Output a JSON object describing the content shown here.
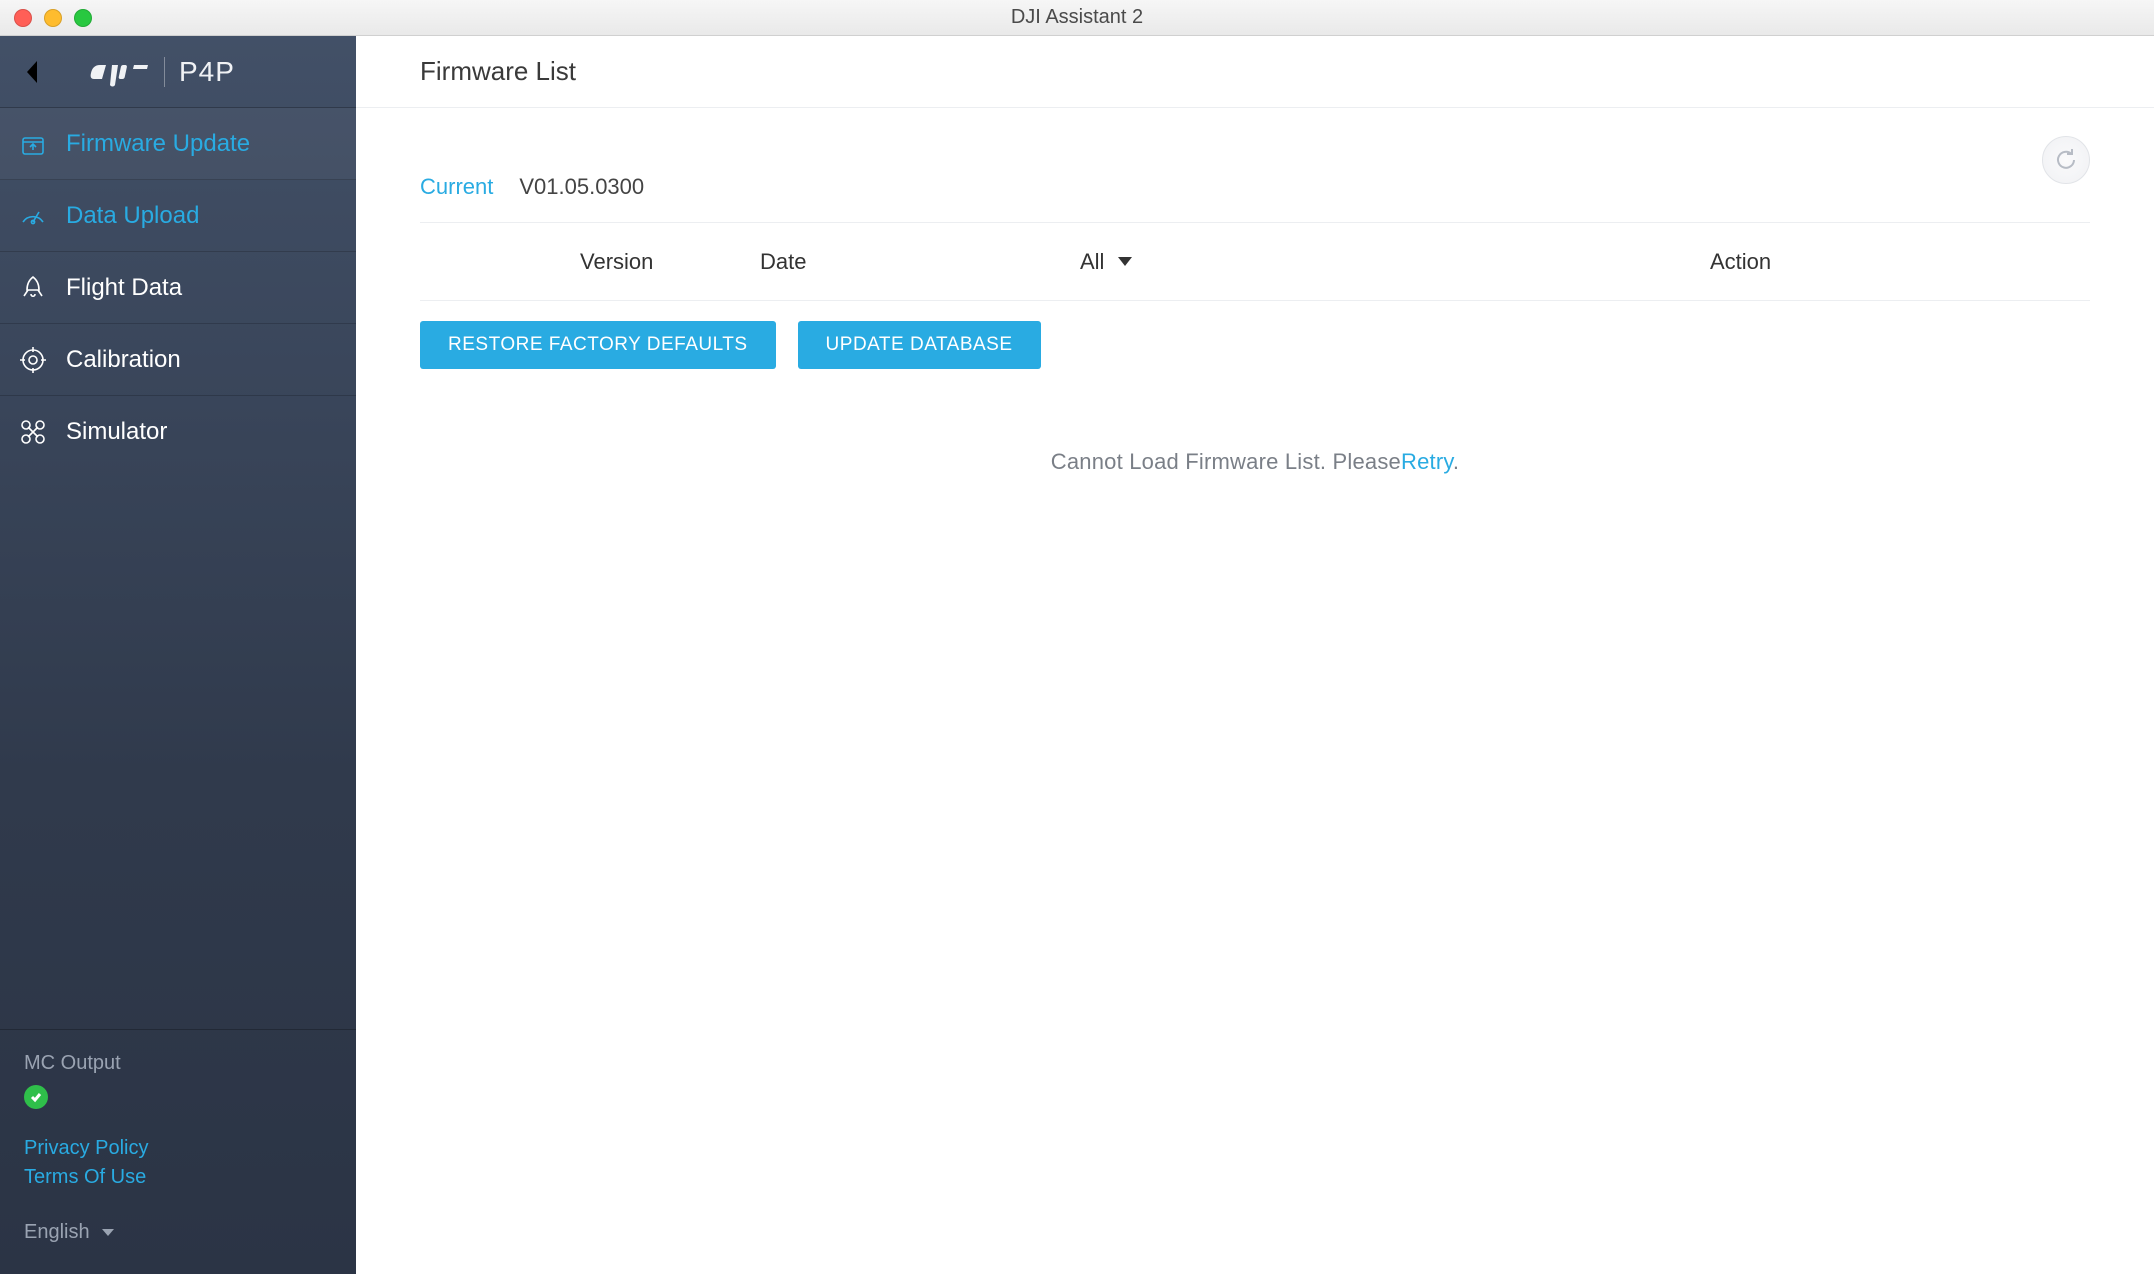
{
  "window": {
    "title": "DJI Assistant 2"
  },
  "brand": {
    "logo_text": "dji",
    "product": "P4P"
  },
  "sidebar": {
    "items": [
      {
        "label": "Firmware Update",
        "icon": "package-up-icon"
      },
      {
        "label": "Data Upload",
        "icon": "gauge-icon"
      },
      {
        "label": "Flight Data",
        "icon": "rocket-icon"
      },
      {
        "label": "Calibration",
        "icon": "target-icon"
      },
      {
        "label": "Simulator",
        "icon": "drone-icon"
      }
    ],
    "mc_output_label": "MC Output",
    "privacy_label": "Privacy Policy",
    "terms_label": "Terms Of Use",
    "language_label": "English"
  },
  "content": {
    "title": "Firmware List",
    "current_label": "Current",
    "current_version": "V01.05.0300",
    "columns": {
      "version": "Version",
      "date": "Date",
      "filter": "All",
      "action": "Action"
    },
    "buttons": {
      "restore": "RESTORE FACTORY DEFAULTS",
      "update_db": "UPDATE DATABASE"
    },
    "error_prefix": "Cannot Load Firmware List. Please",
    "error_retry": "Retry",
    "error_suffix": "."
  },
  "colors": {
    "accent": "#29abe2",
    "sidebar_bg_top": "#425067",
    "sidebar_bg_bottom": "#2b3445",
    "status_ok": "#2fbf4a"
  }
}
